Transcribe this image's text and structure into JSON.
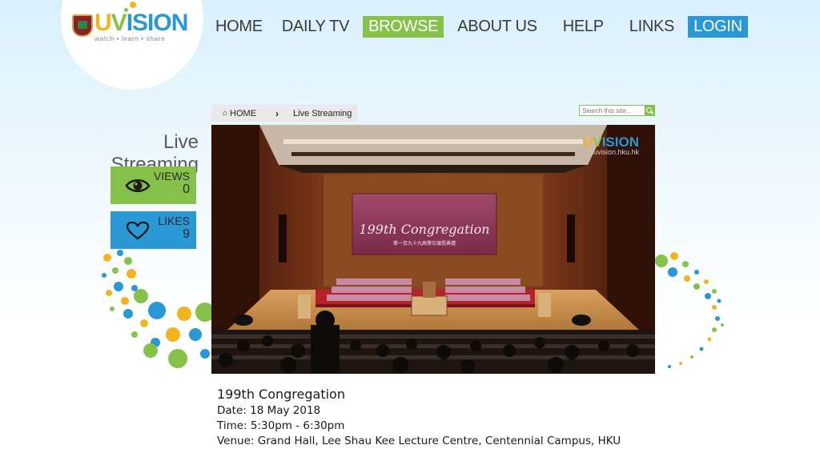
{
  "logo": {
    "word_u": "U",
    "word_v": "V",
    "word_rest": "ISION",
    "tagline": "watch • learn • share"
  },
  "nav": {
    "items": [
      {
        "label": "HOME"
      },
      {
        "label": "DAILY TV"
      },
      {
        "label": "BROWSE",
        "active": true
      },
      {
        "label": "ABOUT US"
      },
      {
        "label": "HELP"
      },
      {
        "label": "LINKS"
      },
      {
        "label": "LOGIN"
      }
    ]
  },
  "breadcrumb": {
    "home": "HOME",
    "current": "Live Streaming",
    "home_icon": "home-icon",
    "separator_icon": "chevron-right-icon"
  },
  "search": {
    "placeholder": "Search this site...",
    "icon": "search-icon"
  },
  "page_title": "Live Streaming",
  "stats": {
    "views": {
      "label": "VIEWS",
      "value": "0",
      "icon": "eye-icon"
    },
    "likes": {
      "label": "LIKES",
      "value": "9",
      "icon": "heart-icon"
    }
  },
  "video": {
    "banner_title": "199th Congregation",
    "banner_subtitle": "第一百九十九屆學位頒授典禮",
    "watermark_u": "U",
    "watermark_v": "V",
    "watermark_rest": "ISION",
    "watermark_url": "uvision.hku.hk"
  },
  "event": {
    "title": "199th Congregation",
    "date": "Date: 18 May 2018",
    "time": "Time: 5:30pm - 6:30pm",
    "venue": "Venue: Grand Hall, Lee Shau Kee Lecture Centre, Centennial Campus, HKU"
  },
  "colors": {
    "green": "#86c24a",
    "blue": "#2a98d4",
    "yellow": "#f2b41c"
  }
}
